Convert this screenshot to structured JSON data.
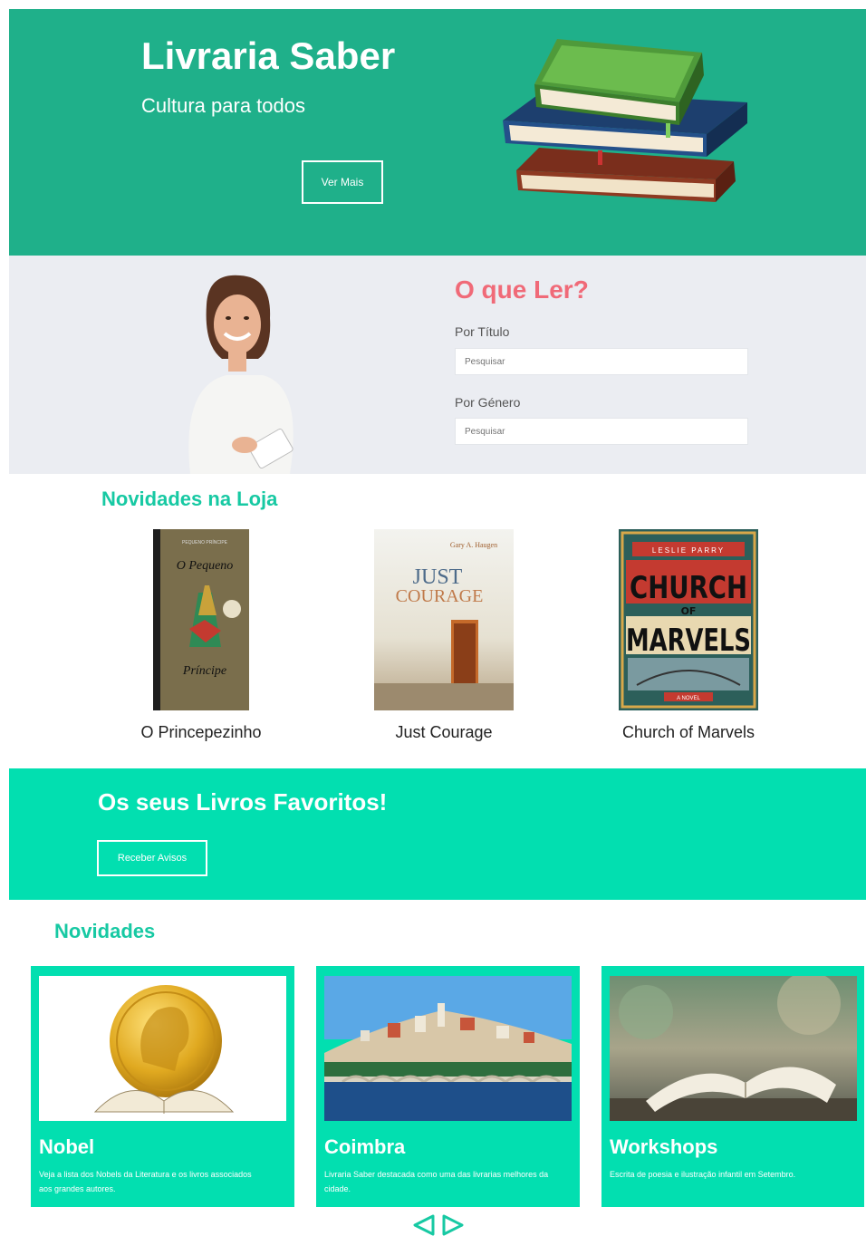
{
  "hero": {
    "title": "Livraria Saber",
    "subtitle": "Cultura para todos",
    "button_label": "Ver Mais"
  },
  "search": {
    "title": "O que Ler?",
    "by_title_label": "Por Título",
    "by_title_placeholder": "Pesquisar",
    "by_genre_label": "Por Género",
    "by_genre_placeholder": "Pesquisar"
  },
  "new_in_store": {
    "title_light": "Novidades",
    "title_bold": "na Loja",
    "books": [
      {
        "caption": "O Princepezinho",
        "cover_top": "PEQUENO PRÍNCIPE",
        "cover_title_1": "O Pequeno",
        "cover_title_2": "Príncipe"
      },
      {
        "caption": "Just Courage",
        "cover_author": "Gary A. Haugen",
        "cover_title_1": "JUST",
        "cover_title_2": "COURAGE"
      },
      {
        "caption": "Church of Marvels",
        "cover_author": "LESLIE PARRY",
        "cover_title_1": "CHURCH",
        "cover_title_2": "OF",
        "cover_title_3": "MARVELS",
        "cover_bottom": "A NOVEL"
      }
    ]
  },
  "favorites": {
    "title": "Os seus Livros Favoritos!",
    "button_label": "Receber Avisos"
  },
  "news": {
    "title": "Novidades",
    "cards": [
      {
        "title": "Nobel",
        "text": "Veja a lista dos Nobels da Literatura e os livros associados aos grandes autores."
      },
      {
        "title": "Coimbra",
        "text": "Livraria Saber destacada como uma das livrarias melhores da cidade."
      },
      {
        "title": "Workshops",
        "text": "Escrita de poesia e ilustração infantil em Setembro."
      }
    ]
  },
  "colors": {
    "hero_bg": "#1fb08a",
    "accent": "#02dfb0",
    "search_title": "#f06a78"
  },
  "icons": [
    "books-stack-image",
    "woman-photo",
    "nobel-medal-image",
    "coimbra-city-image",
    "open-book-image",
    "arrow-left-icon",
    "arrow-right-icon"
  ]
}
